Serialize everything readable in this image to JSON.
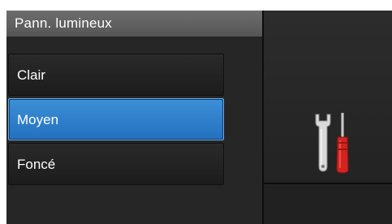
{
  "header": {
    "title": "Pann. lumineux"
  },
  "menu": {
    "items": [
      {
        "label": "Clair",
        "selected": false
      },
      {
        "label": "Moyen",
        "selected": true
      },
      {
        "label": "Foncé",
        "selected": false
      }
    ]
  },
  "right": {
    "icon": "tools-icon"
  },
  "colors": {
    "selected": "#2a7ccc",
    "background": "#262626",
    "title_bar": "#606060"
  }
}
